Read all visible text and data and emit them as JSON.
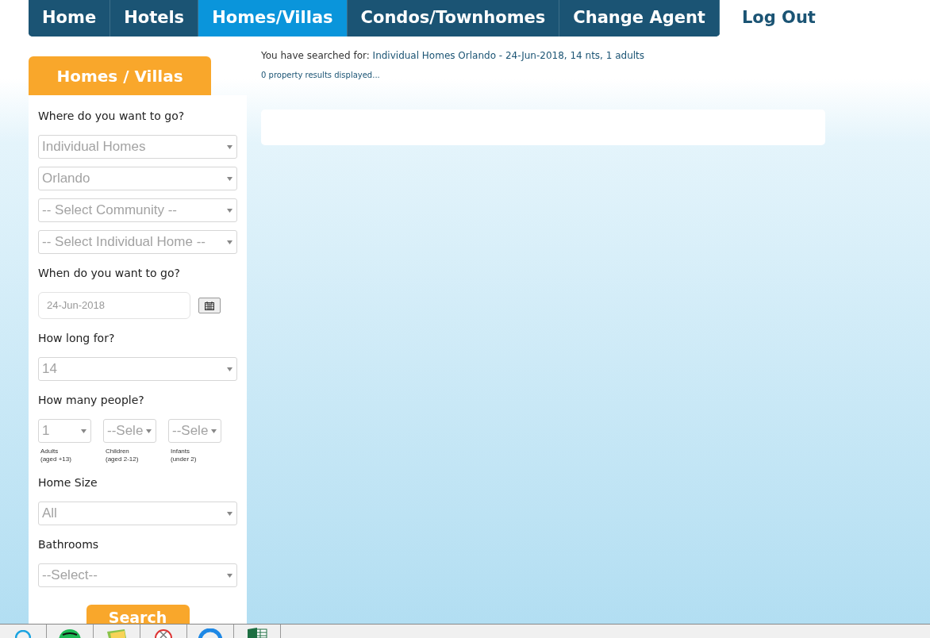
{
  "nav": {
    "items": [
      {
        "label": "Home",
        "selected": false
      },
      {
        "label": "Hotels",
        "selected": false
      },
      {
        "label": "Homes/Villas",
        "selected": true
      },
      {
        "label": "Condos/Townhomes",
        "selected": false
      },
      {
        "label": "Change Agent",
        "selected": false
      }
    ],
    "logout": "Log Out"
  },
  "summary": {
    "prefix": "You have searched for:",
    "query": "Individual Homes Orlando - 24-Jun-2018, 14 nts, 1 adults",
    "results": "0 property results displayed..."
  },
  "sidebar": {
    "title": "Homes / Villas",
    "sections": [
      {
        "label": "Where do you want to go?",
        "controls": [
          {
            "kind": "select",
            "value": "Individual Homes"
          },
          {
            "kind": "select",
            "value": "Orlando"
          },
          {
            "kind": "select",
            "value": "-- Select Community --"
          },
          {
            "kind": "select",
            "value": "-- Select Individual Home --"
          }
        ]
      },
      {
        "label": "When do you want to go?",
        "controls": [
          {
            "kind": "date",
            "value": "24-Jun-2018"
          }
        ]
      },
      {
        "label": "How long for?",
        "controls": [
          {
            "kind": "select",
            "value": "14"
          }
        ]
      },
      {
        "label": "How many people?",
        "controls": [
          {
            "kind": "people",
            "items": [
              {
                "value": "1",
                "caption": "Adults",
                "sub": "(aged +13)"
              },
              {
                "value": "--Sele",
                "caption": "Children",
                "sub": "(aged 2-12)"
              },
              {
                "value": "--Sele",
                "caption": "Infants",
                "sub": "(under 2)"
              }
            ]
          }
        ]
      },
      {
        "label": "Home Size",
        "controls": [
          {
            "kind": "select",
            "value": "All"
          }
        ]
      },
      {
        "label": "Bathrooms",
        "controls": [
          {
            "kind": "select",
            "value": "--Select--"
          }
        ]
      }
    ],
    "button": "Search"
  },
  "taskbar": [
    {
      "kind": "skype"
    },
    {
      "kind": "spotify"
    },
    {
      "kind": "photos"
    },
    {
      "kind": "blocked"
    },
    {
      "kind": "browser"
    },
    {
      "kind": "excel"
    }
  ]
}
